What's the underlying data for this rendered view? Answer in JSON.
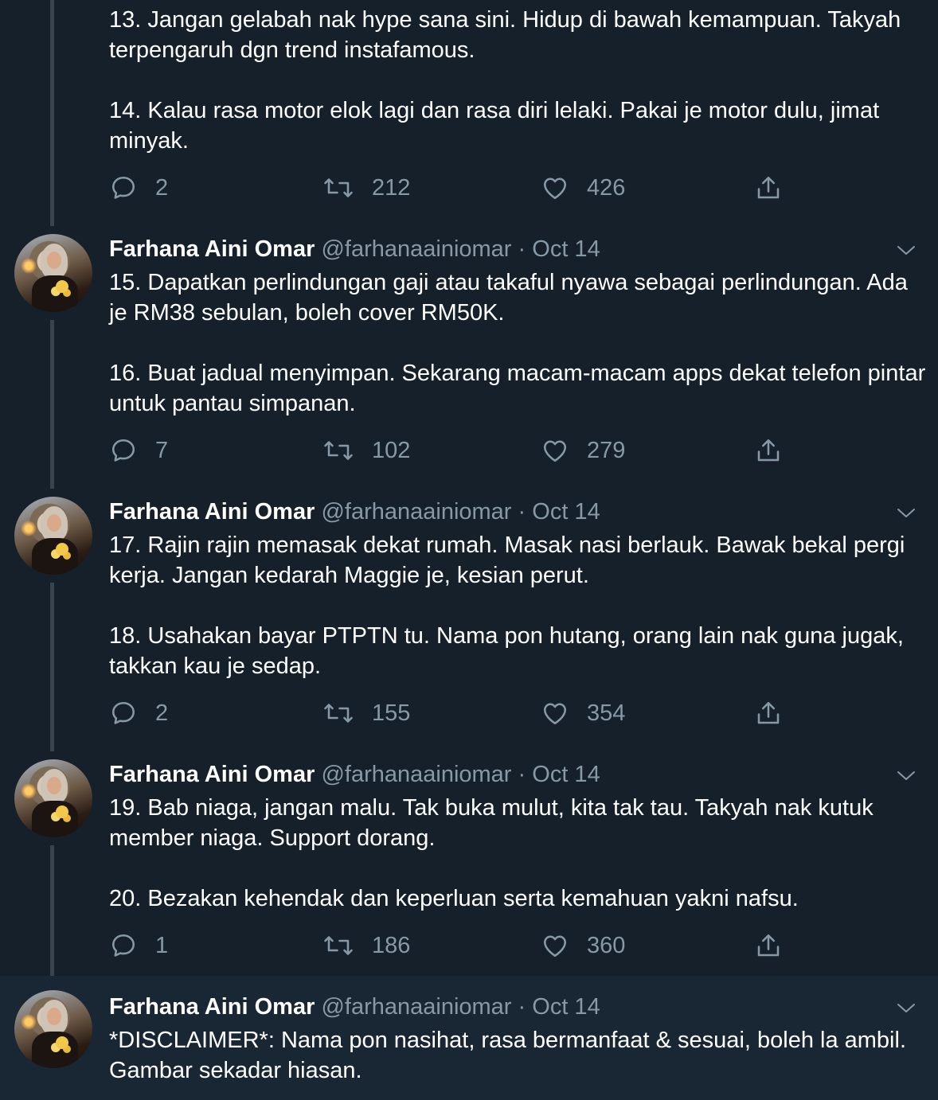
{
  "tweets": [
    {
      "name": "",
      "handle": "",
      "date": "",
      "text": "13. Jangan gelabah nak hype sana sini. Hidup di bawah kemampuan. Takyah terpengaruh dgn trend instafamous.\n\n14. Kalau rasa motor elok lagi dan rasa diri lelaki. Pakai je motor dulu, jimat minyak.",
      "replies": "2",
      "retweets": "212",
      "likes": "426"
    },
    {
      "name": "Farhana Aini Omar",
      "handle": "@farhanaainiomar",
      "date": "Oct 14",
      "text": "15. Dapatkan perlindungan gaji atau takaful nyawa sebagai perlindungan. Ada je RM38 sebulan, boleh cover RM50K.\n\n16. Buat jadual menyimpan. Sekarang macam-macam apps dekat telefon pintar untuk pantau simpanan.",
      "replies": "7",
      "retweets": "102",
      "likes": "279"
    },
    {
      "name": "Farhana Aini Omar",
      "handle": "@farhanaainiomar",
      "date": "Oct 14",
      "text": "17. Rajin rajin memasak dekat rumah. Masak nasi berlauk. Bawak bekal pergi kerja. Jangan kedarah Maggie je, kesian perut.\n\n18. Usahakan bayar PTPTN tu. Nama pon hutang, orang lain nak guna jugak, takkan kau je sedap.",
      "replies": "2",
      "retweets": "155",
      "likes": "354"
    },
    {
      "name": "Farhana Aini Omar",
      "handle": "@farhanaainiomar",
      "date": "Oct 14",
      "text": "19. Bab niaga, jangan malu. Tak buka mulut, kita tak tau. Takyah nak kutuk member niaga. Support dorang.\n\n20. Bezakan kehendak dan keperluan serta kemahuan yakni nafsu.",
      "replies": "1",
      "retweets": "186",
      "likes": "360"
    },
    {
      "name": "Farhana Aini Omar",
      "handle": "@farhanaainiomar",
      "date": "Oct 14",
      "text": "*DISCLAIMER*: Nama pon nasihat, rasa bermanfaat & sesuai, boleh la ambil. Gambar sekadar hiasan.",
      "replies": "",
      "retweets": "",
      "likes": ""
    }
  ],
  "separator": "·",
  "colors": {
    "background": "#15202b",
    "highlight_background": "#192734",
    "secondary_text": "#8899a6",
    "thread_line": "#38444d"
  },
  "icons": [
    "reply-icon",
    "retweet-icon",
    "like-icon",
    "share-icon",
    "chevron-down-icon"
  ]
}
